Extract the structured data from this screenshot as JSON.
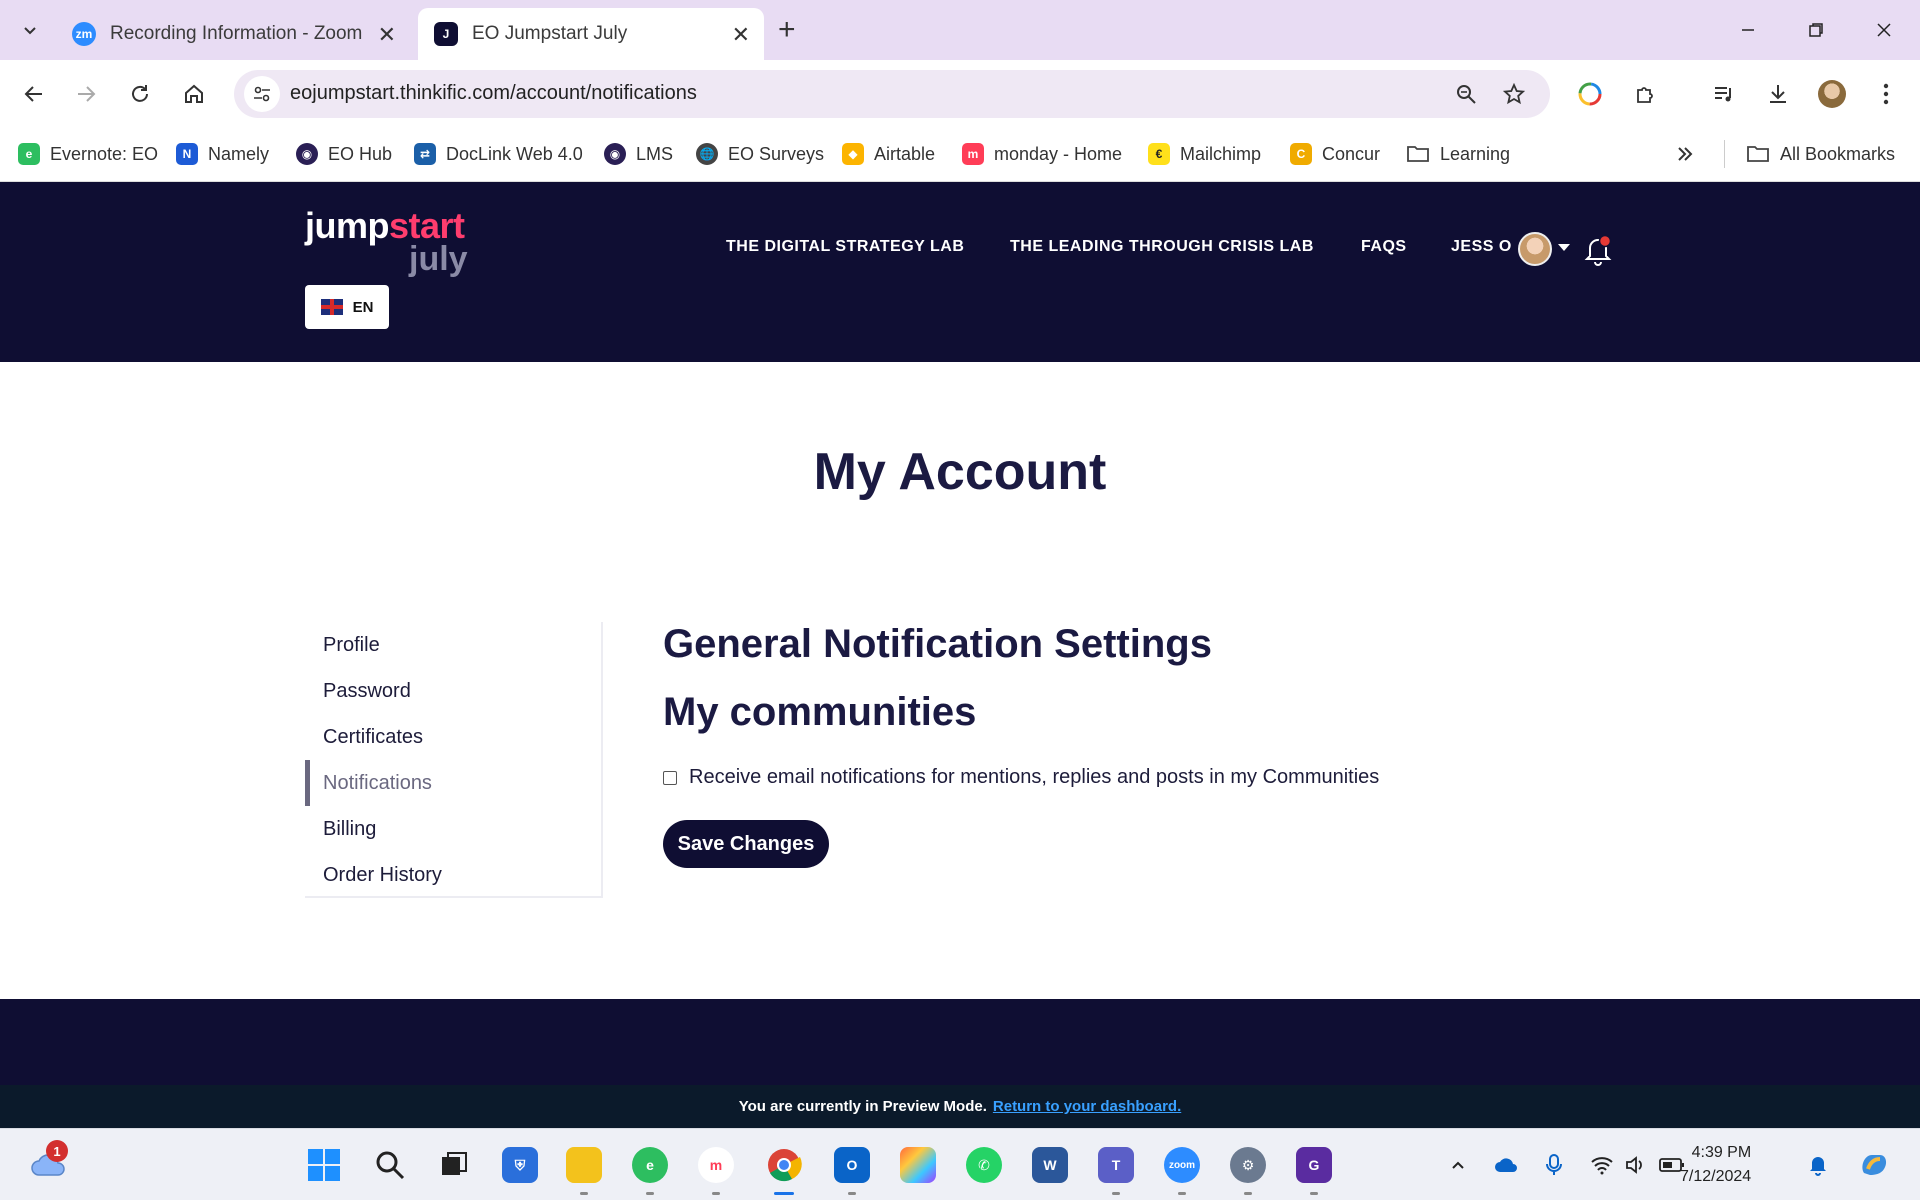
{
  "browser": {
    "tabs": [
      {
        "title": "Recording Information - Zoom",
        "favicon": "zm",
        "active": false
      },
      {
        "title": "EO Jumpstart July",
        "favicon": "J",
        "active": true
      }
    ],
    "address": "eojumpstart.thinkific.com/account/notifications",
    "bookmarks": [
      {
        "label": "Evernote: EO",
        "icon": "evernote-icon",
        "color": "#2dbe60"
      },
      {
        "label": "Namely",
        "icon": "namely-icon",
        "color": "#1d5bd6"
      },
      {
        "label": "EO Hub",
        "icon": "eo-hub-icon",
        "color": "#2a1f55"
      },
      {
        "label": "DocLink Web 4.0",
        "icon": "doclink-icon",
        "color": "#1b5fa8"
      },
      {
        "label": "LMS",
        "icon": "lms-icon",
        "color": "#2a1f55"
      },
      {
        "label": "EO Surveys",
        "icon": "globe-icon",
        "color": "#444444"
      },
      {
        "label": "Airtable",
        "icon": "airtable-icon",
        "color": "#fcb400"
      },
      {
        "label": "monday - Home",
        "icon": "monday-icon",
        "color": "#ff3d57"
      },
      {
        "label": "Mailchimp",
        "icon": "mailchimp-icon",
        "color": "#ffe01b"
      },
      {
        "label": "Concur",
        "icon": "concur-icon",
        "color": "#f0ab00"
      },
      {
        "label": "Learning",
        "icon": "folder-icon",
        "color": "#444444"
      }
    ],
    "all_bookmarks": "All Bookmarks"
  },
  "site": {
    "logo_top": "jump",
    "logo_accent": "start",
    "logo_bottom": "july",
    "language": "EN",
    "nav": [
      "THE DIGITAL STRATEGY LAB",
      "THE LEADING THROUGH CRISIS LAB",
      "FAQS",
      "JESS O"
    ],
    "colors": {
      "header_bg": "#0f0e33",
      "accent_pink": "#ff3d6e"
    }
  },
  "main": {
    "page_title": "My Account",
    "sidebar": [
      {
        "label": "Profile",
        "active": false
      },
      {
        "label": "Password",
        "active": false
      },
      {
        "label": "Certificates",
        "active": false
      },
      {
        "label": "Notifications",
        "active": true
      },
      {
        "label": "Billing",
        "active": false
      },
      {
        "label": "Order History",
        "active": false
      }
    ],
    "heading_general": "General Notification Settings",
    "heading_communities": "My communities",
    "checkbox_label": "Receive email notifications for mentions, replies and posts in my Communities",
    "checkbox_checked": false,
    "save_label": "Save Changes"
  },
  "preview": {
    "text": "You are currently in Preview Mode.",
    "link": "Return to your dashboard."
  },
  "taskbar": {
    "weather_badge": "1",
    "time": "4:39 PM",
    "date": "7/12/2024"
  }
}
